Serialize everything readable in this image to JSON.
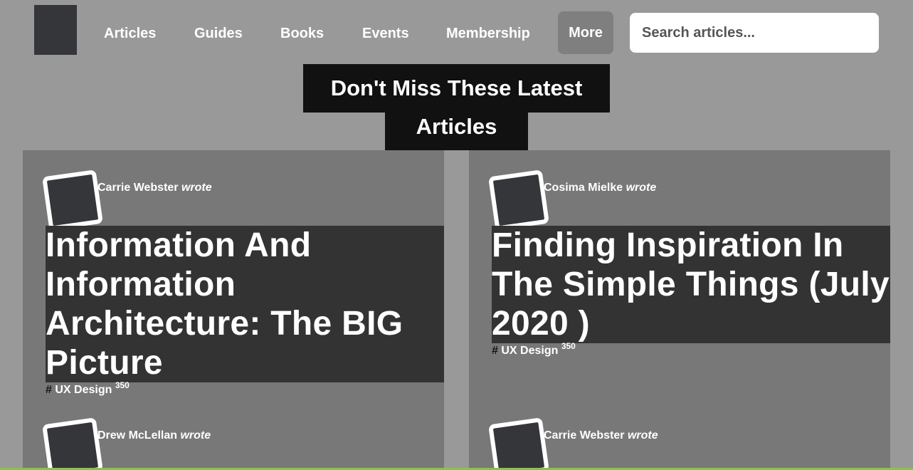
{
  "nav": {
    "items": [
      "Articles",
      "Guides",
      "Books",
      "Events",
      "Membership"
    ],
    "more": "More"
  },
  "search": {
    "placeholder": "Search articles..."
  },
  "heading": {
    "line1": "Don't Miss These Latest",
    "line2": "Articles"
  },
  "articles": [
    {
      "author": "Carrie Webster",
      "wrote": "wrote",
      "title": "Information And Information Architecture: The BIG Picture",
      "tag_hash": "#",
      "tag": "UX Design",
      "count": "350"
    },
    {
      "author": "Cosima Mielke",
      "wrote": "wrote",
      "title": "Finding Inspiration In The Simple Things (July 2020 )",
      "tag_hash": "#",
      "tag": "UX Design",
      "count": "350"
    },
    {
      "author": "Drew McLellan",
      "wrote": "wrote"
    },
    {
      "author": "Carrie Webster",
      "wrote": "wrote"
    }
  ],
  "colors": {
    "page_bg": "#999999",
    "card_bg": "#787878",
    "title_bg": "#333333",
    "heading_bg": "#111111",
    "bottom_accent": "#8bc34a"
  }
}
